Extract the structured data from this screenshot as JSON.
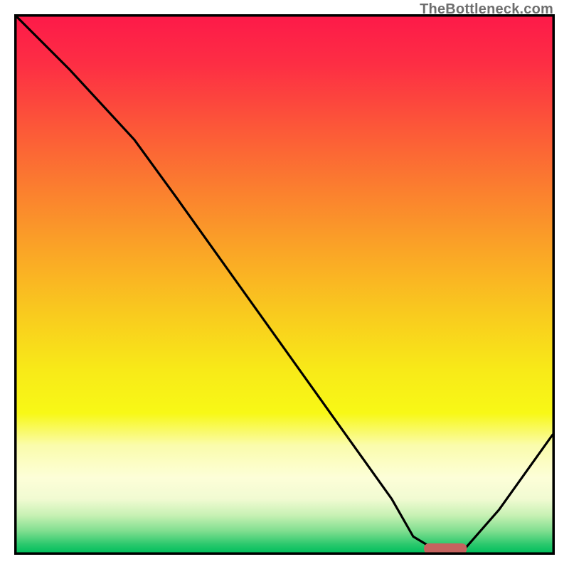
{
  "attribution": "TheBottleneck.com",
  "chart_data": {
    "type": "line",
    "title": "",
    "xlabel": "",
    "ylabel": "",
    "xlim": [
      0,
      100
    ],
    "ylim": [
      0,
      100
    ],
    "grid": false,
    "legend": false,
    "series": [
      {
        "name": "bottleneck-curve",
        "x": [
          0,
          10,
          22,
          30,
          40,
          50,
          60,
          70,
          74,
          79,
          83,
          90,
          100
        ],
        "y": [
          100,
          90,
          77,
          66,
          52,
          38,
          24,
          10,
          3,
          0,
          0,
          8,
          22
        ]
      }
    ],
    "markers": [
      {
        "name": "current-range",
        "shape": "rounded-bar",
        "x_start": 76,
        "x_end": 84,
        "y": 0,
        "color": "#c5635f"
      }
    ],
    "background_gradient": {
      "stops": [
        {
          "offset": 0.0,
          "color": "#fd1a49"
        },
        {
          "offset": 0.09,
          "color": "#fd2e44"
        },
        {
          "offset": 0.2,
          "color": "#fc5539"
        },
        {
          "offset": 0.32,
          "color": "#fb7e2f"
        },
        {
          "offset": 0.44,
          "color": "#faa626"
        },
        {
          "offset": 0.56,
          "color": "#f9cc1e"
        },
        {
          "offset": 0.66,
          "color": "#f8ea18"
        },
        {
          "offset": 0.74,
          "color": "#f8f816"
        },
        {
          "offset": 0.8,
          "color": "#fafcac"
        },
        {
          "offset": 0.86,
          "color": "#fdfed8"
        },
        {
          "offset": 0.9,
          "color": "#f1fbd2"
        },
        {
          "offset": 0.93,
          "color": "#c8f1b4"
        },
        {
          "offset": 0.96,
          "color": "#7fde8f"
        },
        {
          "offset": 0.985,
          "color": "#29c86c"
        },
        {
          "offset": 1.0,
          "color": "#02bf5d"
        }
      ]
    },
    "colors": {
      "curve": "#000000",
      "border": "#000000",
      "marker": "#c5635f"
    }
  }
}
